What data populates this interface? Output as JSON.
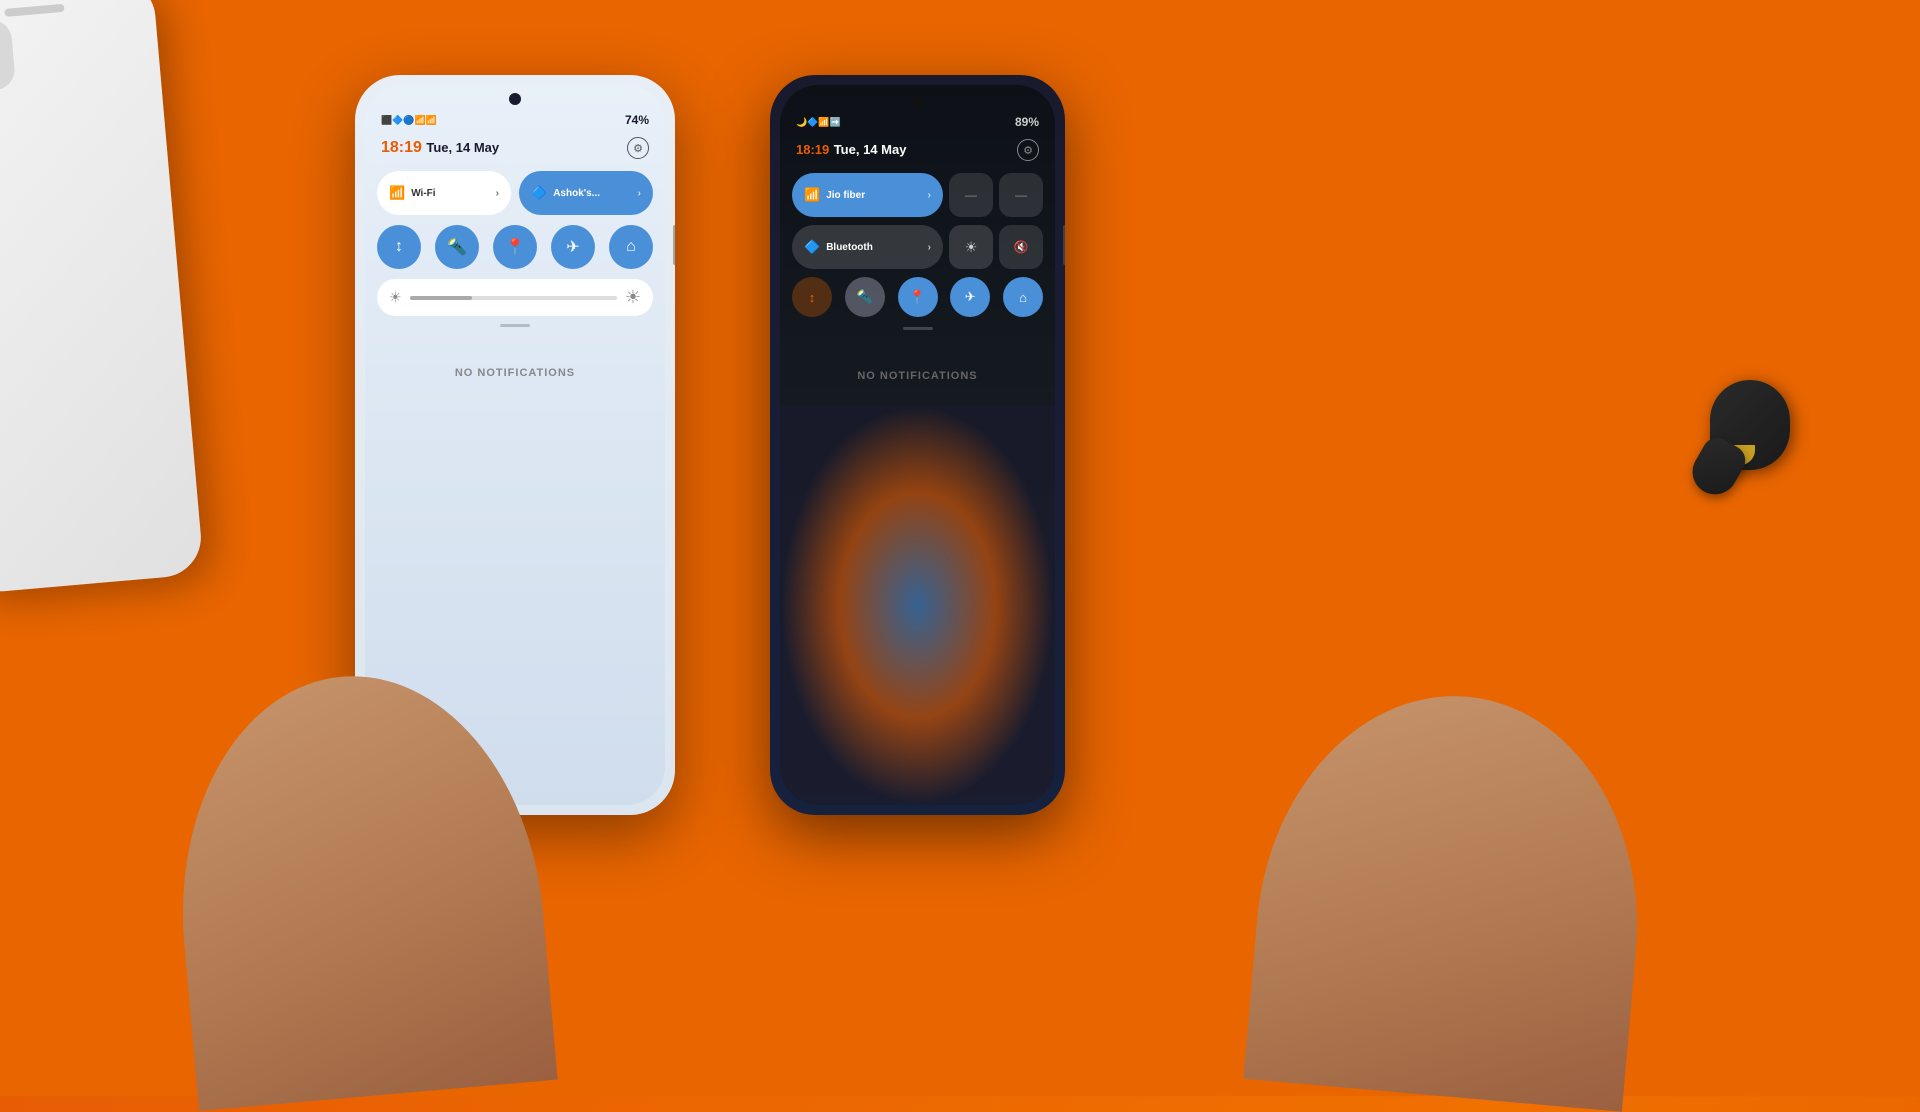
{
  "background": {
    "color": "#e86500"
  },
  "phone_left": {
    "status_bar": {
      "time": "18:19",
      "date": "Tue, 14 May",
      "battery": "74%",
      "icons": [
        "📶",
        "🔋"
      ]
    },
    "datetime": {
      "time": "18:19",
      "date": "Tue, 14 May"
    },
    "wifi_button": {
      "label": "Wi-Fi",
      "icon": "wifi"
    },
    "bluetooth_button": {
      "label": "Ashok's...",
      "icon": "bt"
    },
    "icon_buttons": [
      "↑↓",
      "💡",
      "📍",
      "✈",
      "🏠"
    ],
    "no_notifications": "NO NOTIFICATIONS",
    "settings_icon": "⚙"
  },
  "phone_right": {
    "status_bar": {
      "time": "18:19",
      "date": "Tue, 14 May",
      "battery": "89%",
      "icons": [
        "📶",
        "🔋"
      ]
    },
    "datetime": {
      "time": "18:19",
      "date": "Tue, 14 May"
    },
    "wifi_button": {
      "label": "Jio fiber",
      "icon": "wifi"
    },
    "bluetooth_button": {
      "label": "Bluetooth",
      "icon": "bt"
    },
    "icon_buttons": [
      "↑↓",
      "💡",
      "📍",
      "✈",
      "🏠"
    ],
    "no_notifications": "NO NOTIFICATIONS",
    "settings_icon": "⚙",
    "extra_toggles": [
      "brightness",
      "mute"
    ]
  }
}
